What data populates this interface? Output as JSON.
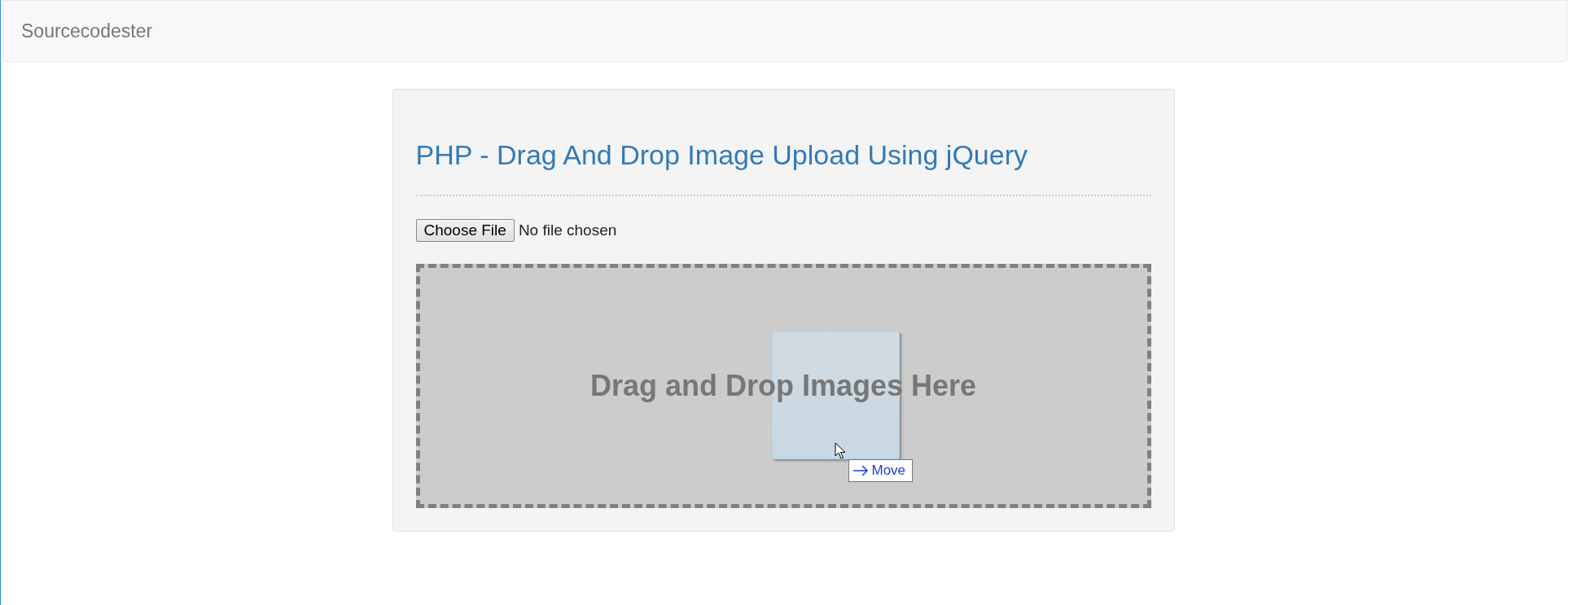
{
  "navbar": {
    "brand": "Sourcecodester"
  },
  "card": {
    "title": "PHP - Drag And Drop Image Upload Using jQuery",
    "file_input": {
      "button": "Choose File",
      "status": "No file chosen"
    },
    "dropzone": {
      "text": "Drag and Drop Images Here"
    },
    "drag_feedback": {
      "label": "Move"
    }
  }
}
